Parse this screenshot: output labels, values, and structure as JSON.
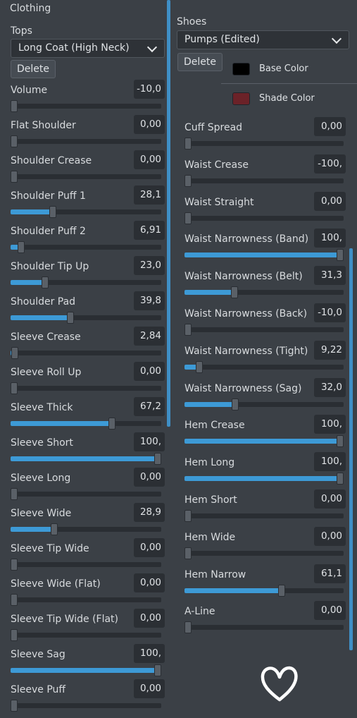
{
  "left": {
    "section_title": "Clothing",
    "category_label": "Tops",
    "dropdown_value": "Long Coat (High Neck)",
    "delete_label": "Delete",
    "sliders": [
      {
        "label": "Volume",
        "value_text": "-10,0",
        "fill": 0.0
      },
      {
        "label": "Flat Shoulder",
        "value_text": "0,00",
        "fill": 0.0
      },
      {
        "label": "Shoulder Crease",
        "value_text": "0,00",
        "fill": 0.0
      },
      {
        "label": "Shoulder Puff 1",
        "value_text": "28,1",
        "fill": 0.281
      },
      {
        "label": "Shoulder Puff 2",
        "value_text": "6,91",
        "fill": 0.069
      },
      {
        "label": "Shoulder Tip Up",
        "value_text": "23,0",
        "fill": 0.23
      },
      {
        "label": "Shoulder Pad",
        "value_text": "39,8",
        "fill": 0.398
      },
      {
        "label": "Sleeve Crease",
        "value_text": "2,84",
        "fill": 0.028
      },
      {
        "label": "Sleeve Roll Up",
        "value_text": "0,00",
        "fill": 0.0
      },
      {
        "label": "Sleeve Thick",
        "value_text": "67,2",
        "fill": 0.672
      },
      {
        "label": "Sleeve Short",
        "value_text": "100,",
        "fill": 1.0
      },
      {
        "label": "Sleeve Long",
        "value_text": "0,00",
        "fill": 0.0
      },
      {
        "label": "Sleeve Wide",
        "value_text": "28,9",
        "fill": 0.289
      },
      {
        "label": "Sleeve Tip Wide",
        "value_text": "0,00",
        "fill": 0.0
      },
      {
        "label": "Sleeve Wide (Flat)",
        "value_text": "0,00",
        "fill": 0.0
      },
      {
        "label": "Sleeve Tip Wide (Flat)",
        "value_text": "0,00",
        "fill": 0.0
      },
      {
        "label": "Sleeve Sag",
        "value_text": "100,",
        "fill": 1.0
      },
      {
        "label": "Sleeve Puff",
        "value_text": "0,00",
        "fill": 0.0
      }
    ]
  },
  "right": {
    "category_label": "Shoes",
    "dropdown_value": "Pumps (Edited)",
    "delete_label": "Delete",
    "base_color_label": "Base Color",
    "base_color": "#000000",
    "shade_color_label": "Shade Color",
    "shade_color": "#6b2228",
    "sliders": [
      {
        "label": "Cuff Spread",
        "value_text": "0,00",
        "fill": 0.0
      },
      {
        "label": "Waist Crease",
        "value_text": "-100,",
        "fill": 0.0
      },
      {
        "label": "Waist Straight",
        "value_text": "0,00",
        "fill": 0.0
      },
      {
        "label": "Waist Narrowness (Band)",
        "value_text": "100,",
        "fill": 1.0
      },
      {
        "label": "Waist Narrowness (Belt)",
        "value_text": "31,3",
        "fill": 0.313
      },
      {
        "label": "Waist Narrowness (Back)",
        "value_text": "-10,0",
        "fill": 0.0
      },
      {
        "label": "Waist Narrowness (Tight)",
        "value_text": "9,22",
        "fill": 0.092
      },
      {
        "label": "Waist Narrowness (Sag)",
        "value_text": "32,0",
        "fill": 0.32
      },
      {
        "label": "Hem Crease",
        "value_text": "100,",
        "fill": 1.0
      },
      {
        "label": "Hem Long",
        "value_text": "100,",
        "fill": 1.0
      },
      {
        "label": "Hem Short",
        "value_text": "0,00",
        "fill": 0.0
      },
      {
        "label": "Hem Wide",
        "value_text": "0,00",
        "fill": 0.0
      },
      {
        "label": "Hem Narrow",
        "value_text": "61,1",
        "fill": 0.611
      },
      {
        "label": "A-Line",
        "value_text": "0,00",
        "fill": 0.0
      }
    ]
  },
  "colors": {
    "accent": "#3d9ad6",
    "background": "#3b4046"
  },
  "icons": {
    "dropdown": "chevron-down-icon",
    "overlay": "heart-icon"
  }
}
